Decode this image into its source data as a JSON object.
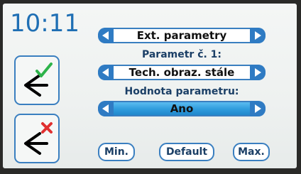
{
  "clock": {
    "time": "10:11"
  },
  "section": {
    "value": "Ext. parametry"
  },
  "parameter": {
    "label": "Parametr č. 1:",
    "value": "Tech. obraz. stále"
  },
  "parameter_value": {
    "label": "Hodnota parametru:",
    "value": "Ano"
  },
  "buttons": {
    "min": "Min.",
    "default": "Default",
    "max": "Max."
  },
  "colors": {
    "accent": "#2f7bc3",
    "confirm": "#2db34a",
    "cancel": "#e03030",
    "selected": "#2e9bdc"
  },
  "icons": {
    "confirm": "back-check-icon",
    "cancel": "back-cross-icon",
    "prev": "arrow-left-icon",
    "next": "arrow-right-icon"
  }
}
